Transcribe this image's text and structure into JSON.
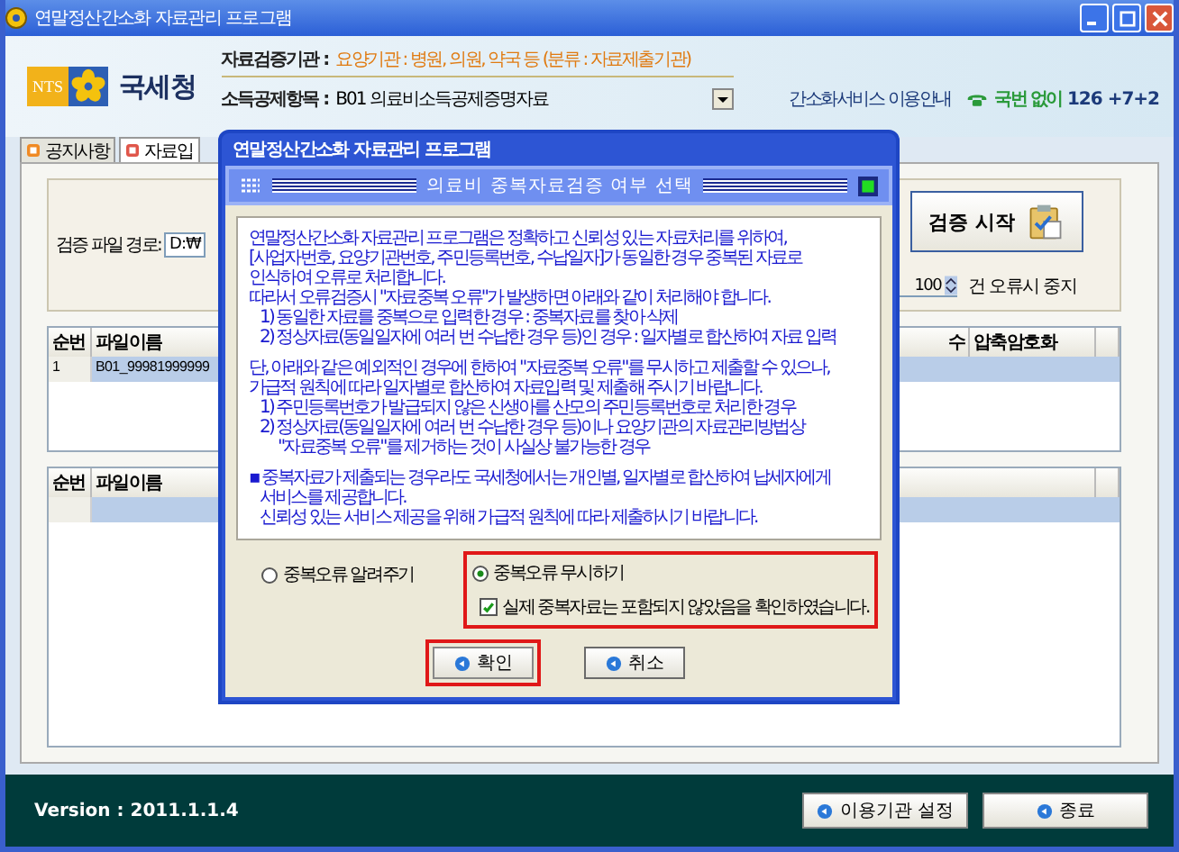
{
  "window": {
    "title": "연말정산간소화 자료관리 프로그램"
  },
  "header": {
    "logo_text": "NTS",
    "org": "국세청",
    "fields": [
      {
        "label": "자료검증기관 :",
        "value": "요양기관 : 병원, 의원, 약국 등 (분류 : 자료제출기관)",
        "kind": "text"
      },
      {
        "label": "소득공제항목 :",
        "value": "B01 의료비소득공제증명자료",
        "kind": "dropdown"
      }
    ],
    "service_link": "간소화서비스 이용안내",
    "phone_prefix": "국번 없이",
    "phone_number": "126 +7+2"
  },
  "tabs": [
    {
      "label": "공지사항",
      "selected": false
    },
    {
      "label": "자료입",
      "selected": true
    }
  ],
  "verify": {
    "path_label": "검증 파일 경로:",
    "path_value": "D:₩",
    "start_button": "검증 시작",
    "error_limit": "100",
    "error_limit_label": "건 오류시 중지"
  },
  "table1": {
    "columns": [
      "순번",
      "파일이름",
      "수",
      "압축암호화"
    ],
    "rows": [
      {
        "cells": [
          "1",
          "B01_99981999999"
        ],
        "selected": true
      }
    ]
  },
  "table2": {
    "columns": [
      "순번",
      "파일이름"
    ]
  },
  "dialog": {
    "title": "연말정산간소화 자료관리 프로그램",
    "banner": "의료비 중복자료검증 여부 선택",
    "paragraphs": [
      [
        {
          "text": "연말정산간소화 자료관리 프로그램은 정확하고 신뢰성 있는 자료처리를 위하여,",
          "kind": "text"
        },
        {
          "text": "[사업자번호, 요양기관번호, 주민등록번호, 수납일자]가 동일한 경우 중복된 자료로",
          "kind": "text"
        },
        {
          "text": "인식하여 오류로 처리합니다.",
          "kind": "text"
        },
        {
          "text": "따라서 오류검증시 \"자료중복 오류\"가 발생하면 아래와 같이 처리해야 합니다.",
          "kind": "text"
        },
        {
          "text": "1) 동일한 자료를 중복으로 입력한 경우 : 중복자료를 찾아 삭제",
          "kind": "item"
        },
        {
          "text": "2) 정상자료(동일일자에 여러 번 수납한 경우 등)인 경우 : 일자별로 합산하여 자료 입력",
          "kind": "item"
        }
      ],
      [
        {
          "text": "단, 아래와 같은 예외적인 경우에 한하여 \"자료중복 오류\"를 무시하고 제출할 수 있으나,",
          "kind": "text"
        },
        {
          "text": "가급적 원칙에 따라 일자별로 합산하여 자료입력 및 제출해 주시기 바랍니다.",
          "kind": "text"
        },
        {
          "text": "1) 주민등록번호가 발급되지 않은 신생아를 산모의 주민등록번호로 처리한 경우",
          "kind": "item"
        },
        {
          "text": "2) 정상자료(동일일자에 여러 번 수납한 경우 등)이나 요양기관의 자료관리방법상",
          "kind": "item"
        },
        {
          "text": "\"자료중복 오류\"를 제거하는 것이 사실상 불가능한 경우",
          "kind": "subitem"
        }
      ],
      [
        {
          "text": "▪ 중복자료가 제출되는 경우라도 국세청에서는 개인별, 일자별로 합산하여 납세자에게",
          "kind": "text"
        },
        {
          "text": "서비스를 제공합니다.",
          "kind": "item"
        },
        {
          "text": "신뢰성 있는 서비스 제공을 위해 가급적 원칙에 따라 제출하시기 바랍니다.",
          "kind": "item"
        }
      ]
    ],
    "options": [
      {
        "label": "중복오류 알려주기",
        "selected": false,
        "highlighted": false
      },
      {
        "label": "중복오류 무시하기",
        "selected": true,
        "highlighted": true
      }
    ],
    "confirm": {
      "label": "실제 중복자료는 포함되지 않았음을 확인하였습니다.",
      "checked": true
    },
    "buttons": [
      {
        "label": "확인",
        "highlighted": true
      },
      {
        "label": "취소",
        "highlighted": false
      }
    ]
  },
  "footer": {
    "version": "Version : 2011.1.1.4",
    "buttons": [
      "이용기관 설정",
      "종료"
    ]
  }
}
